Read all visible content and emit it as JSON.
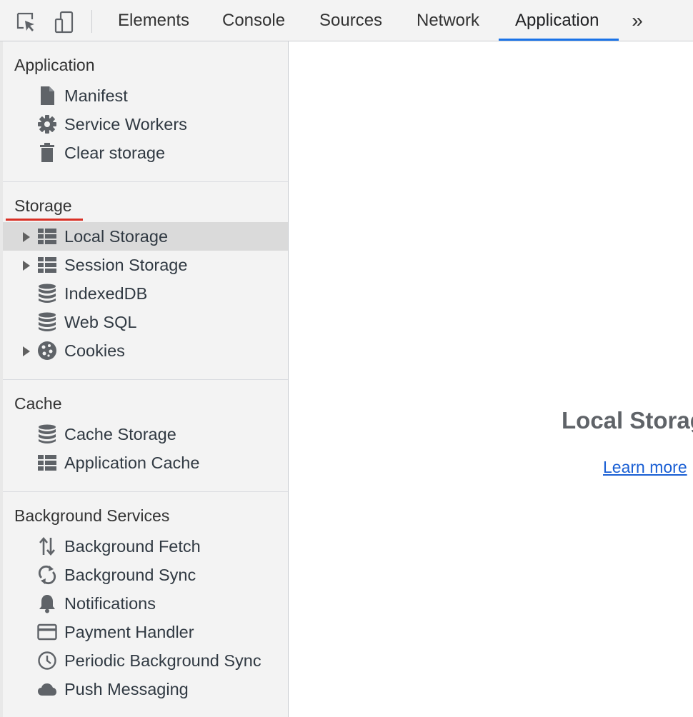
{
  "toolbar": {
    "tabs": [
      {
        "label": "Elements"
      },
      {
        "label": "Console"
      },
      {
        "label": "Sources"
      },
      {
        "label": "Network"
      },
      {
        "label": "Application"
      }
    ],
    "more_label": "»",
    "accent": "#1a73e8"
  },
  "sidebar": {
    "sections": [
      {
        "title": "Application",
        "items": [
          {
            "label": "Manifest",
            "icon": "document-icon"
          },
          {
            "label": "Service Workers",
            "icon": "gear-icon"
          },
          {
            "label": "Clear storage",
            "icon": "trash-icon"
          }
        ]
      },
      {
        "title": "Storage",
        "items": [
          {
            "label": "Local Storage",
            "icon": "grid-icon",
            "expandable": true,
            "selected": true
          },
          {
            "label": "Session Storage",
            "icon": "grid-icon",
            "expandable": true
          },
          {
            "label": "IndexedDB",
            "icon": "database-icon"
          },
          {
            "label": "Web SQL",
            "icon": "database-icon"
          },
          {
            "label": "Cookies",
            "icon": "cookie-icon",
            "expandable": true
          }
        ]
      },
      {
        "title": "Cache",
        "items": [
          {
            "label": "Cache Storage",
            "icon": "database-icon"
          },
          {
            "label": "Application Cache",
            "icon": "grid-icon"
          }
        ]
      },
      {
        "title": "Background Services",
        "items": [
          {
            "label": "Background Fetch",
            "icon": "up-down-arrows-icon"
          },
          {
            "label": "Background Sync",
            "icon": "sync-icon"
          },
          {
            "label": "Notifications",
            "icon": "bell-icon"
          },
          {
            "label": "Payment Handler",
            "icon": "credit-card-icon"
          },
          {
            "label": "Periodic Background Sync",
            "icon": "clock-icon"
          },
          {
            "label": "Push Messaging",
            "icon": "cloud-icon"
          }
        ]
      }
    ]
  },
  "main": {
    "title": "Local Storage",
    "learn_more": "Learn more"
  }
}
